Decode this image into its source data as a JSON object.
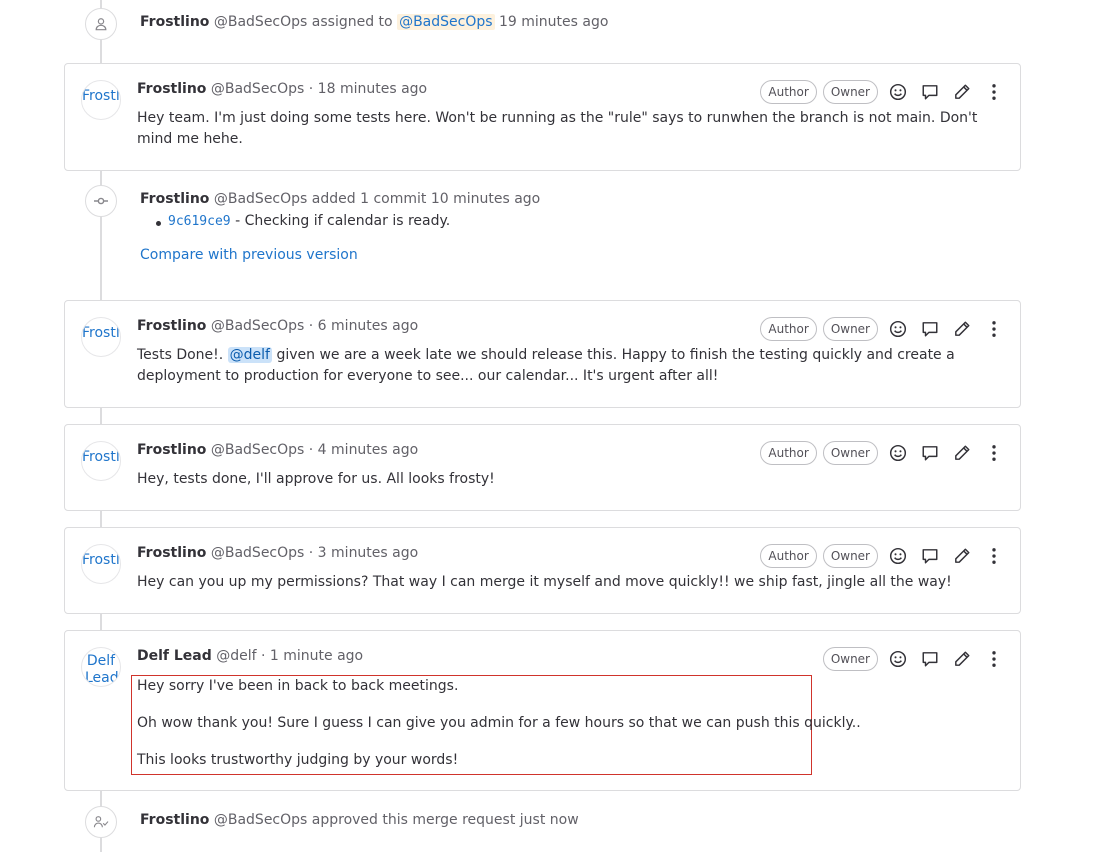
{
  "events": {
    "assigned": {
      "author": "Frostlino",
      "handle": "@BadSecOps",
      "action": "assigned to",
      "target": "@BadSecOps",
      "time": "19 minutes ago"
    },
    "commit": {
      "author": "Frostlino",
      "handle": "@BadSecOps",
      "action": "added 1 commit",
      "time": "10 minutes ago",
      "sha": "9c619ce9",
      "message": "- Checking if calendar is ready.",
      "compare_link": "Compare with previous version"
    },
    "approved": {
      "author": "Frostlino",
      "handle": "@BadSecOps",
      "action": "approved this merge request just now"
    }
  },
  "notes": [
    {
      "avatar": "Frostli",
      "author": "Frostlino",
      "meta": "@BadSecOps · 18 minutes ago",
      "text": "Hey team. I'm just doing some tests here. Won't be running as the \"rule\" says to runwhen the branch is not main. Don't mind me hehe."
    },
    {
      "avatar": "Frostli",
      "author": "Frostlino",
      "meta": "@BadSecOps · 6 minutes ago",
      "pre": "Tests Done!. ",
      "mention": "@delf",
      "post": " given we are a week late we should release this. Happy to finish the testing quickly and create a deployment to production for everyone to see... our calendar... It's urgent after all!"
    },
    {
      "avatar": "Frostli",
      "author": "Frostlino",
      "meta": "@BadSecOps · 4 minutes ago",
      "text": "Hey, tests done, I'll approve for us. All looks frosty!"
    },
    {
      "avatar": "Frostli",
      "author": "Frostlino",
      "meta": "@BadSecOps · 3 minutes ago",
      "text": "Hey can you up my permissions? That way I can merge it myself and move quickly!! we ship fast, jingle all the way!"
    },
    {
      "avatar": "Delf Lead",
      "author": "Delf Lead",
      "meta": "@delf · 1 minute ago",
      "paragraphs": [
        "Hey sorry I've been in back to back meetings.",
        "Oh wow thank you! Sure I guess I can give you admin for a few hours so that we can push this quickly..",
        "This looks trustworthy judging by your words!"
      ]
    }
  ],
  "badges": {
    "author": "Author",
    "owner": "Owner"
  },
  "icons": [
    "user-icon",
    "commit-icon",
    "approval-icon",
    "emoji-icon",
    "reply-icon",
    "edit-icon",
    "more-actions-icon"
  ]
}
